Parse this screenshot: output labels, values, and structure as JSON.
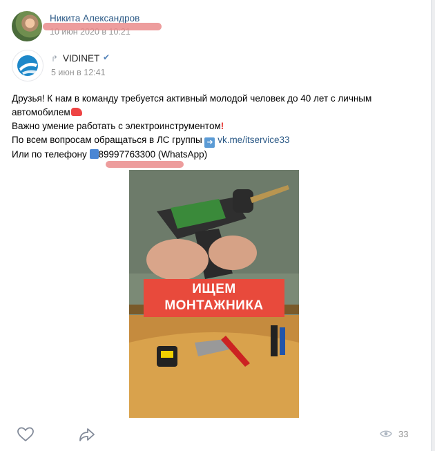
{
  "author": {
    "name": "Никита Александров",
    "date": "10 июн 2020 в 10:21"
  },
  "source": {
    "name": "VIDINET",
    "verified_icon": "check-icon",
    "repost_icon": "repost-icon",
    "date": "5 июн в 12:41"
  },
  "post": {
    "line1": "Друзья! К нам в команду требуется активный молодой человек до 40 лет с личным",
    "line2": "автомобилем",
    "line3": "Важно умение работать с электроинструментом",
    "line4_prefix": "По всем вопросам обращаться в ЛС группы",
    "line4_link": "vk.me/itservice33",
    "line5_prefix": "Или по телефону",
    "phone": "89997763300",
    "line5_suffix": "(WhatsApp)"
  },
  "image": {
    "banner_line1": "ИЩЕМ",
    "banner_line2": "МОНТАЖНИКА"
  },
  "actions": {
    "like_icon": "heart-icon",
    "share_icon": "share-icon",
    "views_icon": "eye-icon",
    "views_count": "33"
  },
  "colors": {
    "link": "#2a5885",
    "muted": "#939393",
    "banner": "#e84a3c",
    "redaction": "#ea8c8c"
  }
}
